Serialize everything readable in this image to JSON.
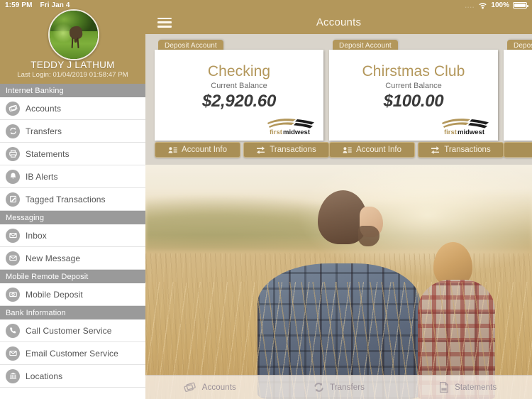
{
  "status_bar": {
    "time": "1:59 PM",
    "date": "Fri Jan 4",
    "signal_dots": "....",
    "wifi_icon": "wifi-icon",
    "battery_percent": "100%",
    "battery_icon": "battery-full-icon"
  },
  "sidebar": {
    "user_name": "TEDDY J LATHUM",
    "last_login": "Last Login: 01/04/2019 01:58:47 PM",
    "avatar_icon": "user-avatar-deer-photo",
    "sections": [
      {
        "title": "Internet Banking",
        "items": [
          {
            "label": "Accounts",
            "icon": "cards-icon"
          },
          {
            "label": "Transfers",
            "icon": "circular-arrows-icon"
          },
          {
            "label": "Statements",
            "icon": "printer-icon"
          },
          {
            "label": "IB Alerts",
            "icon": "bell-icon"
          },
          {
            "label": "Tagged Transactions",
            "icon": "tag-note-icon"
          }
        ]
      },
      {
        "title": "Messaging",
        "items": [
          {
            "label": "Inbox",
            "icon": "inbox-envelope-icon"
          },
          {
            "label": "New Message",
            "icon": "envelope-icon"
          }
        ]
      },
      {
        "title": "Mobile Remote Deposit",
        "items": [
          {
            "label": "Mobile Deposit",
            "icon": "camera-icon"
          }
        ]
      },
      {
        "title": "Bank Information",
        "items": [
          {
            "label": "Call Customer Service",
            "icon": "phone-icon"
          },
          {
            "label": "Email Customer Service",
            "icon": "envelope-icon"
          },
          {
            "label": "Locations",
            "icon": "bank-building-icon"
          }
        ]
      }
    ]
  },
  "navbar": {
    "menu_icon": "hamburger-menu-icon",
    "title": "Accounts"
  },
  "accounts": {
    "brand_name_first": "first",
    "brand_name_second": "midwest",
    "cards": [
      {
        "tab_label": "Deposit Account",
        "name": "Checking",
        "balance_label": "Current Balance",
        "balance": "$2,920.60",
        "logo_icon": "firstmidwest-logo",
        "buttons": [
          {
            "label": "Account Info",
            "icon": "account-info-icon"
          },
          {
            "label": "Transactions",
            "icon": "transactions-arrows-icon"
          }
        ]
      },
      {
        "tab_label": "Deposit Account",
        "name": "Chirstmas Club",
        "balance_label": "Current Balance",
        "balance": "$100.00",
        "logo_icon": "firstmidwest-logo",
        "buttons": [
          {
            "label": "Account Info",
            "icon": "account-info-icon"
          },
          {
            "label": "Transactions",
            "icon": "transactions-arrows-icon"
          }
        ]
      },
      {
        "tab_label": "Deposit Account",
        "name": "",
        "balance_label": "",
        "balance": "",
        "logo_icon": "firstmidwest-logo",
        "buttons": [
          {
            "label": "",
            "icon": "account-info-icon"
          },
          {
            "label": "",
            "icon": "transactions-arrows-icon"
          }
        ]
      }
    ]
  },
  "hero_image": {
    "description": "man-and-child-in-golden-field-photo"
  },
  "tabbar": {
    "tabs": [
      {
        "label": "Accounts",
        "icon": "cards-icon"
      },
      {
        "label": "Transfers",
        "icon": "circular-arrows-icon"
      },
      {
        "label": "Statements",
        "icon": "pdf-document-icon"
      }
    ]
  },
  "colors": {
    "brand_gold": "#b3975b",
    "section_header_gray": "#9a9a9a",
    "card_panel_bg": "#d9d4cb",
    "button_gold": "#a98f56"
  }
}
